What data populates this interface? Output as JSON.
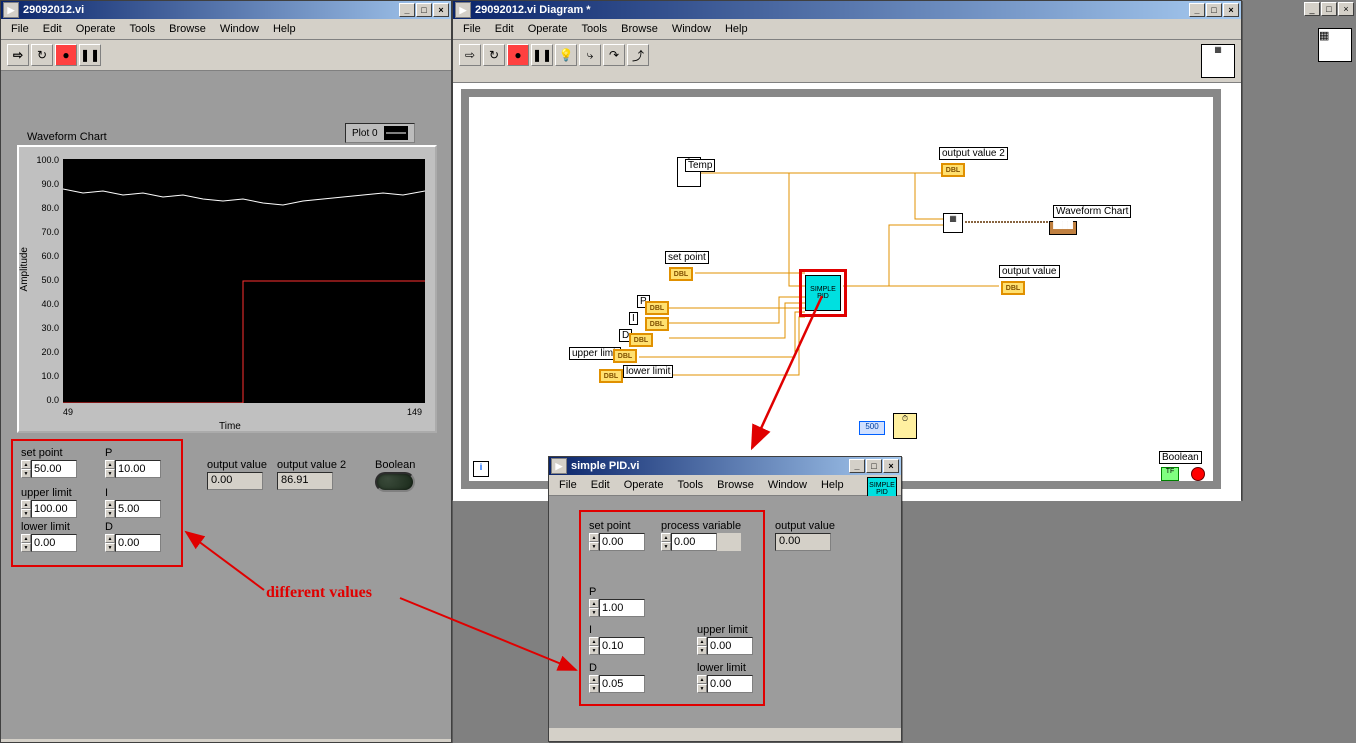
{
  "fp_window": {
    "title": "29092012.vi",
    "menu": [
      "File",
      "Edit",
      "Operate",
      "Tools",
      "Browse",
      "Window",
      "Help"
    ],
    "chart_title": "Waveform Chart",
    "legend": "Plot 0",
    "ylabel": "Amplitude",
    "xlabel": "Time",
    "yticks": [
      "0.0",
      "10.0",
      "20.0",
      "30.0",
      "40.0",
      "50.0",
      "60.0",
      "70.0",
      "80.0",
      "90.0",
      "100.0"
    ],
    "xtick_min": "49",
    "xtick_max": "149",
    "controls": {
      "set_point": {
        "label": "set point",
        "value": "50.00"
      },
      "upper_limit": {
        "label": "upper limit",
        "value": "100.00"
      },
      "lower_limit": {
        "label": "lower limit",
        "value": "0.00"
      },
      "P": {
        "label": "P",
        "value": "10.00"
      },
      "I": {
        "label": "I",
        "value": "5.00"
      },
      "D": {
        "label": "D",
        "value": "0.00"
      },
      "output_value": {
        "label": "output value",
        "value": "0.00"
      },
      "output_value_2": {
        "label": "output value 2",
        "value": "86.91"
      },
      "boolean": {
        "label": "Boolean"
      }
    }
  },
  "bd_window": {
    "title": "29092012.vi Diagram *",
    "menu": [
      "File",
      "Edit",
      "Operate",
      "Tools",
      "Browse",
      "Window",
      "Help"
    ],
    "labels": {
      "temp": "Temp",
      "set_point": "set point",
      "P": "P",
      "I": "I",
      "D": "D",
      "upper_limit": "upper limit",
      "lower_limit": "lower limit",
      "output_value": "output value",
      "output_value_2": "output value 2",
      "waveform_chart": "Waveform Chart",
      "boolean": "Boolean",
      "delay": "500",
      "pid": "SIMPLE PID"
    }
  },
  "pid_window": {
    "title": "simple PID.vi",
    "menu": [
      "File",
      "Edit",
      "Operate",
      "Tools",
      "Browse",
      "Window",
      "Help"
    ],
    "controls": {
      "set_point": {
        "label": "set point",
        "value": "0.00"
      },
      "process_variable": {
        "label": "process variable",
        "value": "0.00"
      },
      "output_value": {
        "label": "output value",
        "value": "0.00"
      },
      "P": {
        "label": "P",
        "value": "1.00"
      },
      "I": {
        "label": "I",
        "value": "0.10"
      },
      "D": {
        "label": "D",
        "value": "0.05"
      },
      "upper_limit": {
        "label": "upper limit",
        "value": "0.00"
      },
      "lower_limit": {
        "label": "lower limit",
        "value": "0.00"
      }
    }
  },
  "annotation": "different values",
  "chart_data": {
    "type": "line",
    "title": "Waveform Chart",
    "xlabel": "Time",
    "ylabel": "Amplitude",
    "xlim": [
      49,
      149
    ],
    "ylim": [
      0,
      100
    ],
    "series": [
      {
        "name": "white",
        "x": [
          49,
          55,
          60,
          65,
          70,
          75,
          80,
          85,
          90,
          95,
          100,
          105,
          110,
          115,
          120,
          125,
          130,
          135,
          140,
          145,
          149
        ],
        "values": [
          88,
          86,
          87,
          85,
          86,
          84,
          85,
          83,
          82,
          83,
          81,
          80,
          82,
          83,
          84,
          85,
          86,
          85,
          86,
          87,
          87
        ]
      },
      {
        "name": "red-setpoint",
        "x": [
          49,
          99,
          99,
          149
        ],
        "values": [
          0,
          0,
          50,
          50
        ]
      }
    ]
  }
}
